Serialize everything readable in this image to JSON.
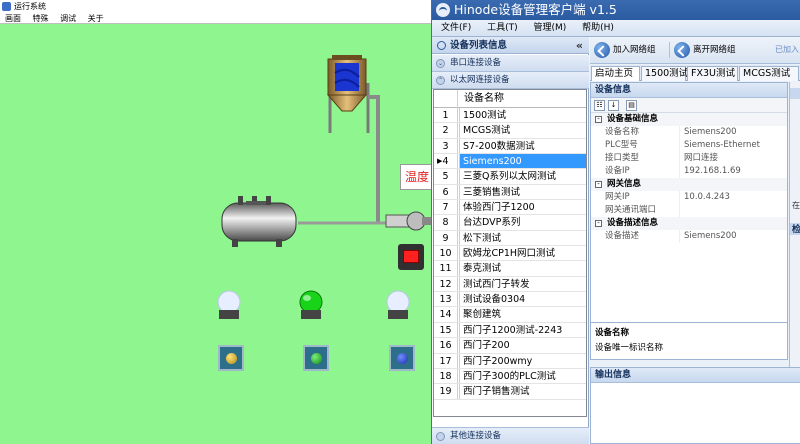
{
  "background_app": {
    "title": "运行系统",
    "menu": [
      "画面",
      "特殊",
      "调试",
      "关于"
    ],
    "temperature_label": "温度"
  },
  "app": {
    "title": "Hinode设备管理客户端 v1.5",
    "menu": [
      "文件(F)",
      "工具(T)",
      "管理(M)",
      "帮助(H)"
    ]
  },
  "left_panel": {
    "header": "设备列表信息",
    "collapse_glyph": "«",
    "serial_section": "串口连接设备",
    "ethernet_section": "以太网连接设备",
    "other_section": "其他连接设备",
    "grid": {
      "column_header": "设备名称",
      "selected_index": 4,
      "rows": [
        {
          "index": "1",
          "name": "1500测试"
        },
        {
          "index": "2",
          "name": "MCGS测试"
        },
        {
          "index": "3",
          "name": "S7-200数据测试"
        },
        {
          "index": "4",
          "name": "Siemens200"
        },
        {
          "index": "5",
          "name": "三菱Q系列以太网测试"
        },
        {
          "index": "6",
          "name": "三菱销售测试"
        },
        {
          "index": "7",
          "name": "体验西门子1200"
        },
        {
          "index": "8",
          "name": "台达DVP系列"
        },
        {
          "index": "9",
          "name": "松下测试"
        },
        {
          "index": "10",
          "name": "欧姆龙CP1H网口测试"
        },
        {
          "index": "11",
          "name": "泰克测试"
        },
        {
          "index": "12",
          "name": "测试西门子转发"
        },
        {
          "index": "13",
          "name": "测试设备0304"
        },
        {
          "index": "14",
          "name": "聚创建筑"
        },
        {
          "index": "15",
          "name": "西门子1200测试-2243"
        },
        {
          "index": "16",
          "name": "西门子200"
        },
        {
          "index": "17",
          "name": "西门子200wmy"
        },
        {
          "index": "18",
          "name": "西门子300的PLC测试"
        },
        {
          "index": "19",
          "name": "西门子销售测试"
        }
      ]
    }
  },
  "toolbar": {
    "join_label": "加入网络组",
    "leave_label": "离开网络组",
    "faded_label": "已加入"
  },
  "tabs": [
    "启动主页",
    "1500测试",
    "FX3U测试",
    "MCGS测试"
  ],
  "active_tab": 0,
  "device_info": {
    "title": "设备信息",
    "groups": [
      {
        "title": "设备基础信息",
        "rows": [
          {
            "key": "设备名称",
            "value": "Siemens200"
          },
          {
            "key": "PLC型号",
            "value": "Siemens-Ethernet"
          },
          {
            "key": "接口类型",
            "value": "网口连接"
          },
          {
            "key": "设备IP",
            "value": "192.168.1.69"
          }
        ]
      },
      {
        "title": "网关信息",
        "rows": [
          {
            "key": "网关IP",
            "value": "10.0.4.243"
          },
          {
            "key": "网关通讯端口",
            "value": ""
          }
        ]
      },
      {
        "title": "设备描述信息",
        "rows": [
          {
            "key": "设备描述",
            "value": "Siemens200"
          }
        ]
      }
    ],
    "desc_title": "设备名称",
    "desc_text": "设备唯一标识名称"
  },
  "output": {
    "title": "输出信息"
  },
  "side_strip": {
    "text1": "在",
    "text2": "检"
  },
  "colors": {
    "scada_bg": "#8ff58f",
    "selection": "#3399ff",
    "title_bar": "#2a5aa0",
    "lamp_green": "#18d418",
    "lamp_off": "#dde8ff",
    "alarm_red": "#ff2020"
  }
}
